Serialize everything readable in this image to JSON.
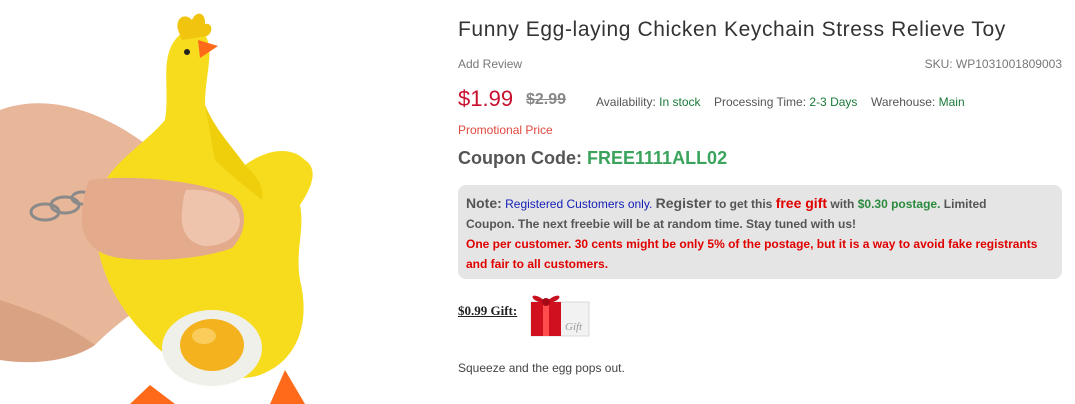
{
  "product": {
    "title": "Funny Egg-laying Chicken Keychain Stress Relieve Toy",
    "add_review": "Add Review",
    "sku": "SKU: WP1031001809003",
    "price": "$1.99",
    "old_price": "$2.99",
    "availability_label": "Availability:",
    "availability_value": "In stock",
    "processing_label": "Processing Time:",
    "processing_value": "2-3 Days",
    "warehouse_label": "Warehouse:",
    "warehouse_value": "Main",
    "promo": "Promotional Price",
    "coupon_label": "Coupon Code:",
    "coupon_code": "FREE1111ALL02",
    "description": "Squeeze and the egg pops out."
  },
  "note": {
    "label": "Note:",
    "registered": "Registered Customers only.",
    "register": "Register",
    "get_this": "to get this",
    "free_gift": "free gift",
    "with": "with",
    "postage": "$0.30 postage.",
    "limited": "Limited",
    "line2": "Coupon. The next freebie will be at random time. Stay tuned with us!",
    "line3": "One per customer. 30 cents might be only 5% of the postage, but it is a way to avoid fake registrants",
    "line4": "and fair to all customers."
  },
  "gift": {
    "label": "$0.99 Gift:",
    "badge": "Gift",
    "icon": "gift-box-icon"
  },
  "colors": {
    "price": "#c8102e",
    "coupon_code": "#3aa35c",
    "note_bg": "#e5e5e5",
    "in_stock": "#1a7a3a"
  }
}
